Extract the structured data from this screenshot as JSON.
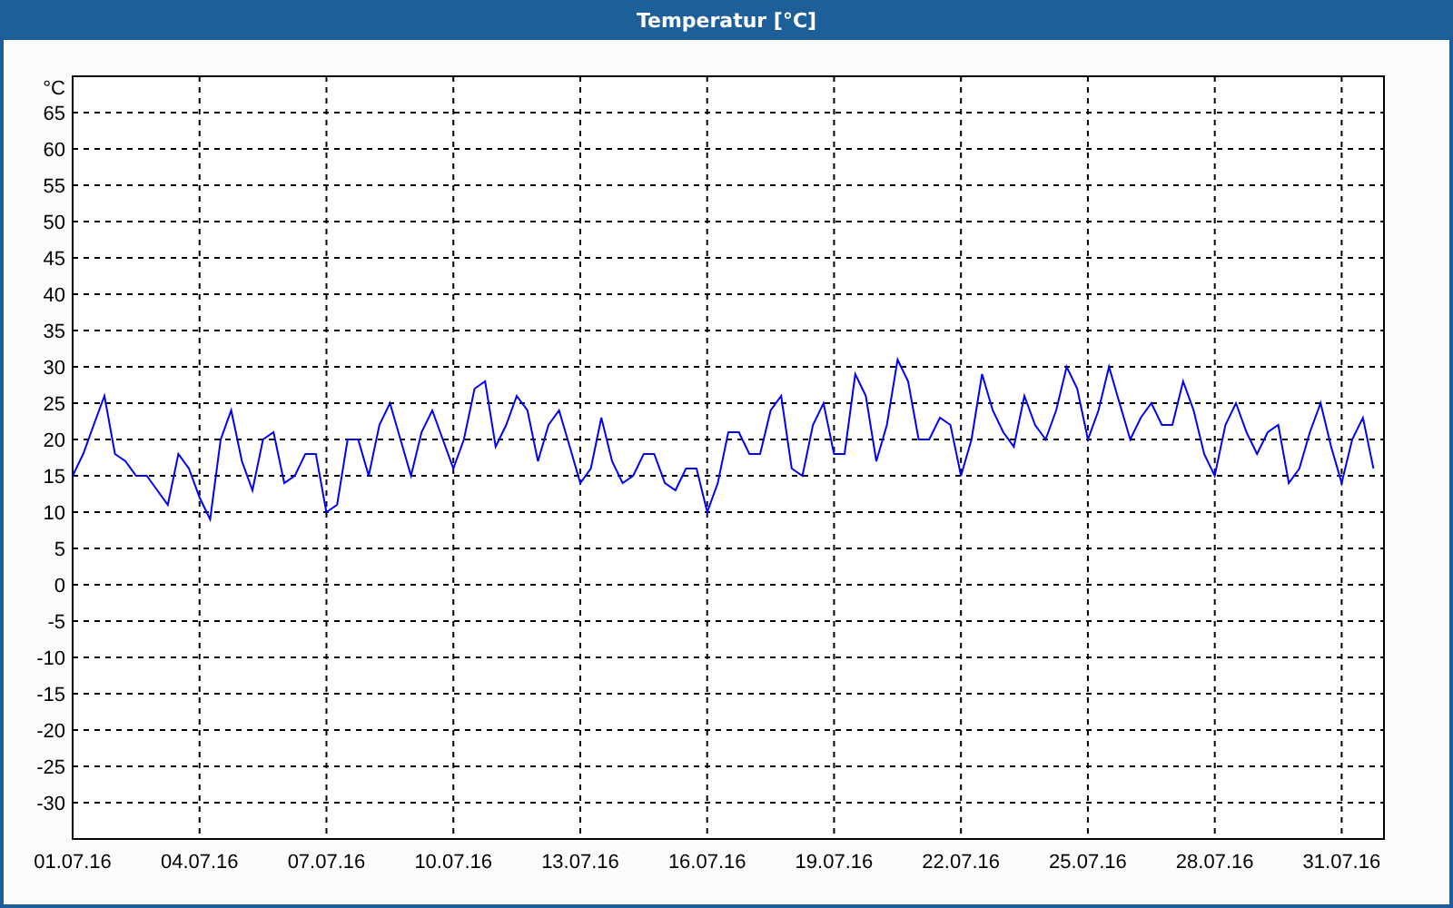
{
  "window": {
    "title": "Temperatur [°C]"
  },
  "chart": {
    "chart_data": {
      "type": "line",
      "grid": true,
      "ylabel": "°C",
      "ylim": [
        -35,
        70
      ],
      "yticks": [
        -30,
        -25,
        -20,
        -15,
        -10,
        -5,
        0,
        5,
        10,
        15,
        20,
        25,
        30,
        35,
        40,
        45,
        50,
        55,
        60,
        65
      ],
      "categories": [
        "01.07.16",
        null,
        null,
        null,
        null,
        null,
        null,
        null,
        null,
        null,
        null,
        null,
        "04.07.16",
        null,
        null,
        null,
        null,
        null,
        null,
        null,
        null,
        null,
        null,
        null,
        "07.07.16",
        null,
        null,
        null,
        null,
        null,
        null,
        null,
        null,
        null,
        null,
        null,
        "10.07.16",
        null,
        null,
        null,
        null,
        null,
        null,
        null,
        null,
        null,
        null,
        null,
        "13.07.16",
        null,
        null,
        null,
        null,
        null,
        null,
        null,
        null,
        null,
        null,
        null,
        "16.07.16",
        null,
        null,
        null,
        null,
        null,
        null,
        null,
        null,
        null,
        null,
        null,
        "19.07.16",
        null,
        null,
        null,
        null,
        null,
        null,
        null,
        null,
        null,
        null,
        null,
        "22.07.16",
        null,
        null,
        null,
        null,
        null,
        null,
        null,
        null,
        null,
        null,
        null,
        "25.07.16",
        null,
        null,
        null,
        null,
        null,
        null,
        null,
        null,
        null,
        null,
        null,
        "28.07.16",
        null,
        null,
        null,
        null,
        null,
        null,
        null,
        null,
        null,
        null,
        null,
        "31.07.16",
        null,
        null,
        null
      ],
      "series": [
        {
          "color": "#0000ff",
          "values": [
            15,
            18,
            22,
            26,
            18,
            17,
            15,
            15,
            13,
            11,
            18,
            16,
            12,
            9,
            20,
            24,
            17,
            13,
            20,
            21,
            14,
            15,
            18,
            18,
            10,
            11,
            20,
            20,
            15,
            22,
            25,
            20,
            15,
            21,
            24,
            20,
            16,
            20,
            27,
            28,
            19,
            22,
            26,
            24,
            17,
            22,
            24,
            19,
            14,
            16,
            23,
            17,
            14,
            15,
            18,
            18,
            14,
            13,
            16,
            16,
            10,
            14,
            21,
            21,
            18,
            18,
            24,
            26,
            16,
            15,
            22,
            25,
            18,
            18,
            29,
            26,
            17,
            22,
            31,
            28,
            20,
            20,
            23,
            22,
            15,
            20,
            29,
            24,
            21,
            19,
            26,
            22,
            20,
            24,
            30,
            27,
            20,
            24,
            30,
            25,
            20,
            23,
            25,
            22,
            22,
            28,
            24,
            18,
            15,
            22,
            25,
            21,
            18,
            21,
            22,
            14,
            16,
            21,
            25,
            19,
            14,
            20,
            23,
            16
          ]
        }
      ]
    }
  }
}
